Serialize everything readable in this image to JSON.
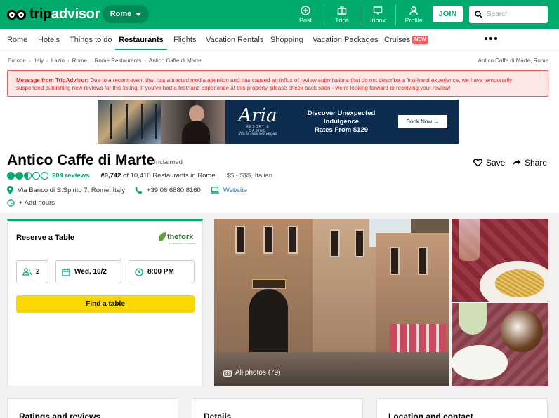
{
  "header": {
    "logo_text_trip": "trip",
    "logo_text_advisor": "advisor",
    "geo": "Rome",
    "nav": [
      {
        "label": "Post",
        "icon": "plus-circle-icon"
      },
      {
        "label": "Trips",
        "icon": "briefcase-icon"
      },
      {
        "label": "Inbox",
        "icon": "inbox-icon"
      },
      {
        "label": "Profile",
        "icon": "person-icon"
      }
    ],
    "join": "JOIN",
    "search_placeholder": "Search"
  },
  "navbar": {
    "items": [
      "Rome",
      "Hotels",
      "Things to do",
      "Restaurants",
      "Flights",
      "Vacation Rentals",
      "Shopping",
      "Vacation Packages",
      "Cruises"
    ],
    "active": "Restaurants",
    "new_badge": "NEW"
  },
  "breadcrumb": {
    "items": [
      "Europe",
      "Italy",
      "Lazio",
      "Rome",
      "Rome Restaurants",
      "Antico Caffe di Marte"
    ],
    "right": "Antico Caffe di Marte, Rome"
  },
  "alert": {
    "bold": "Message from TripAdvisor:",
    "text": " Due to a recent event that has attracted media attention and has caused an influx of review submissions that do not describe a first-hand experience, we have temporarily suspended publishing new reviews for this listing. If you've had a firsthand experience at this property, please check back soon - we're looking forward to receiving your review!"
  },
  "ad": {
    "brand": "Aria",
    "brand_sub": "RESORT & CASINO",
    "tagline": "this is how we vegas",
    "headline_1": "Discover Unexpected",
    "headline_2": "Indulgence",
    "headline_3": "Rates From $129",
    "cta": "Book Now →"
  },
  "restaurant": {
    "name": "Antico Caffe di Marte",
    "claim_status": "Unclaimed",
    "save": "Save",
    "share": "Share",
    "rating_bubbles": 2.5,
    "reviews": "204 reviews",
    "rank_bold": "#9,742",
    "rank_rest": " of 10,410 Restaurants in Rome",
    "price": "$$ - $$$, Italian",
    "address": "Via Banco di S.Spirito 7, Rome, Italy",
    "phone": "+39 06 6880 8160",
    "website": "Website",
    "hours": "+ Add hours"
  },
  "reserve": {
    "title": "Reserve a Table",
    "partner": "thefork",
    "partner_sub": "a tripadvisor company",
    "party": "2",
    "date": "Wed, 10/2",
    "time": "8:00 PM",
    "cta": "Find a table"
  },
  "photos": {
    "all_label": "All photos (79)"
  },
  "sections": [
    "Ratings and reviews",
    "Details",
    "Location and contact"
  ],
  "colors": {
    "brand_green": "#00aa6c",
    "alert_red": "#d42b2b",
    "cta_yellow": "#fad700"
  }
}
